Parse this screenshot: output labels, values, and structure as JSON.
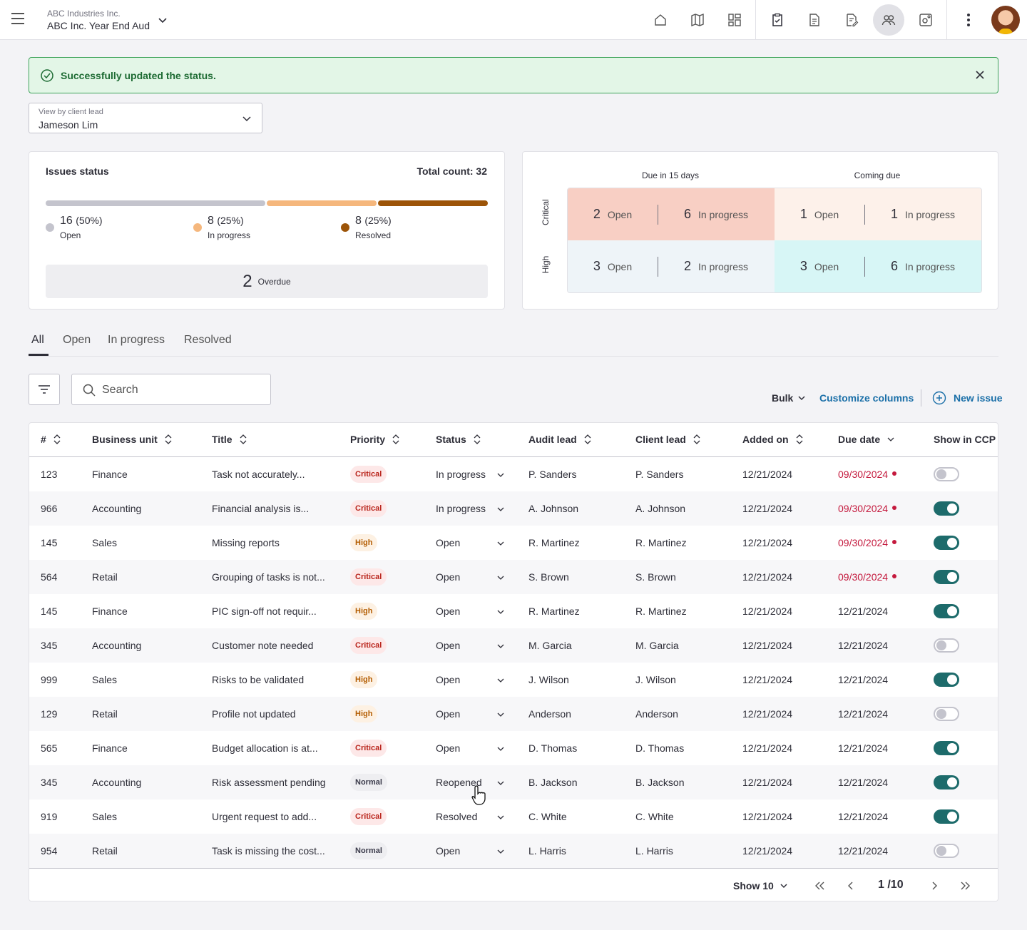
{
  "header": {
    "org": "ABC Industries Inc.",
    "engagement": "ABC Inc. Year  End Aud",
    "nav_icons": [
      "home-icon",
      "map-icon",
      "grid-icon",
      "clipboard-check-icon",
      "document-icon",
      "document-edit-icon",
      "users-icon",
      "settings-icon"
    ],
    "active_icon": "users-icon"
  },
  "toast": {
    "message": "Successfully updated the status."
  },
  "client_filter": {
    "label": "View by client lead",
    "value": "Jameson Lim"
  },
  "issues_status": {
    "title": "Issues status",
    "total": "Total count: 32",
    "segments": [
      {
        "count": "16",
        "pct": "(50%)",
        "label": "Open",
        "color": "#c4c4cd",
        "fraction": 0.5
      },
      {
        "count": "8",
        "pct": "(25%)",
        "label": "In progress",
        "color": "#f5b77d",
        "fraction": 0.25
      },
      {
        "count": "8",
        "pct": "(25%)",
        "label": "Resolved",
        "color": "#9c5408",
        "fraction": 0.25
      }
    ],
    "overdue_count": "2",
    "overdue_label": "Overdue"
  },
  "matrix": {
    "columns": [
      "Due in 15 days",
      "Coming due"
    ],
    "rows": [
      "Critical",
      "High"
    ],
    "cells": [
      {
        "open": "2",
        "open_label": "Open",
        "inprog": "6",
        "inprog_label": "In progress",
        "color": "#f8cfc4"
      },
      {
        "open": "1",
        "open_label": "Open",
        "inprog": "1",
        "inprog_label": "In progress",
        "color": "#fdf1ea"
      },
      {
        "open": "3",
        "open_label": "Open",
        "inprog": "2",
        "inprog_label": "In progress",
        "color": "#eef4f8"
      },
      {
        "open": "3",
        "open_label": "Open",
        "inprog": "6",
        "inprog_label": "In progress",
        "color": "#d7f6f6"
      }
    ]
  },
  "tabs": [
    "All",
    "Open",
    "In progress",
    "Resolved"
  ],
  "toolbar": {
    "search_placeholder": "Search",
    "bulk": "Bulk",
    "customize": "Customize columns",
    "new_issue": "New issue"
  },
  "table": {
    "headers": [
      "#",
      "Business unit",
      "Title",
      "Priority",
      "Status",
      "Audit lead",
      "Client lead",
      "Added on",
      "Due date",
      "Show in CCP"
    ],
    "rows": [
      {
        "id": "123",
        "unit": "Finance",
        "title": "Task not accurately...",
        "priority": "Critical",
        "status": "In progress",
        "audit": "P. Sanders",
        "client": "P. Sanders",
        "added": "12/21/2024",
        "due": "09/30/2024",
        "overdue": true,
        "ccp": false
      },
      {
        "id": "966",
        "unit": "Accounting",
        "title": "Financial analysis is...",
        "priority": "Critical",
        "status": "In progress",
        "audit": "A. Johnson",
        "client": "A. Johnson",
        "added": "12/21/2024",
        "due": "09/30/2024",
        "overdue": true,
        "ccp": true
      },
      {
        "id": "145",
        "unit": "Sales",
        "title": "Missing reports",
        "priority": "High",
        "status": "Open",
        "audit": "R. Martinez",
        "client": "R. Martinez",
        "added": "12/21/2024",
        "due": "09/30/2024",
        "overdue": true,
        "ccp": true
      },
      {
        "id": "564",
        "unit": "Retail",
        "title": "Grouping of tasks is not...",
        "priority": "Critical",
        "status": "Open",
        "audit": "S. Brown",
        "client": "S. Brown",
        "added": "12/21/2024",
        "due": "09/30/2024",
        "overdue": true,
        "ccp": true
      },
      {
        "id": "145",
        "unit": "Finance",
        "title": "PIC sign-off not requir...",
        "priority": "High",
        "status": "Open",
        "audit": "R. Martinez",
        "client": "R. Martinez",
        "added": "12/21/2024",
        "due": "12/21/2024",
        "overdue": false,
        "ccp": true
      },
      {
        "id": "345",
        "unit": "Accounting",
        "title": "Customer note needed",
        "priority": "Critical",
        "status": "Open",
        "audit": "M. Garcia",
        "client": "M. Garcia",
        "added": "12/21/2024",
        "due": "12/21/2024",
        "overdue": false,
        "ccp": false
      },
      {
        "id": "999",
        "unit": "Sales",
        "title": "Risks to be validated",
        "priority": "High",
        "status": "Open",
        "audit": "J. Wilson",
        "client": "J. Wilson",
        "added": "12/21/2024",
        "due": "12/21/2024",
        "overdue": false,
        "ccp": true
      },
      {
        "id": "129",
        "unit": "Retail",
        "title": "Profile not updated",
        "priority": "High",
        "status": "Open",
        "audit": "Anderson",
        "client": "Anderson",
        "added": "12/21/2024",
        "due": "12/21/2024",
        "overdue": false,
        "ccp": false
      },
      {
        "id": "565",
        "unit": "Finance",
        "title": "Budget allocation is at...",
        "priority": "Critical",
        "status": "Open",
        "audit": "D. Thomas",
        "client": "D. Thomas",
        "added": "12/21/2024",
        "due": "12/21/2024",
        "overdue": false,
        "ccp": true
      },
      {
        "id": "345",
        "unit": "Accounting",
        "title": "Risk assessment pending",
        "priority": "Normal",
        "status": "Reopened",
        "audit": "B. Jackson",
        "client": "B. Jackson",
        "added": "12/21/2024",
        "due": "12/21/2024",
        "overdue": false,
        "ccp": true
      },
      {
        "id": "919",
        "unit": "Sales",
        "title": "Urgent request to add...",
        "priority": "Critical",
        "status": "Resolved",
        "audit": "C. White",
        "client": "C. White",
        "added": "12/21/2024",
        "due": "12/21/2024",
        "overdue": false,
        "ccp": true
      },
      {
        "id": "954",
        "unit": "Retail",
        "title": "Task is missing the cost...",
        "priority": "Normal",
        "status": "Open",
        "audit": "L. Harris",
        "client": "L. Harris",
        "added": "12/21/2024",
        "due": "12/21/2024",
        "overdue": false,
        "ccp": false
      }
    ]
  },
  "pagination": {
    "show": "Show 10",
    "page": "1 /10"
  }
}
